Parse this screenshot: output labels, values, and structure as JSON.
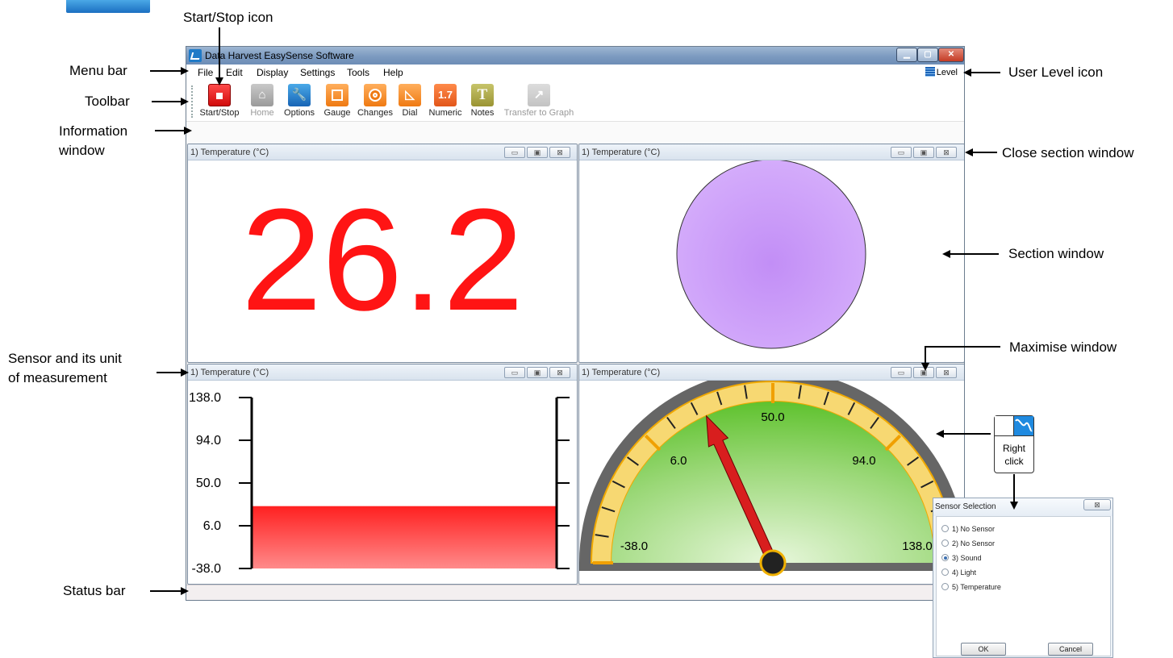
{
  "callouts": {
    "start_stop_icon": "Start/Stop icon",
    "menu_bar": "Menu bar",
    "toolbar": "Toolbar",
    "information_window_1": "Information",
    "information_window_2": "window",
    "sensor_unit_1": "Sensor and its unit",
    "sensor_unit_2": "of measurement",
    "status_bar": "Status bar",
    "user_level_icon": "User Level icon",
    "close_section_window": "Close section window",
    "section_window": "Section window",
    "maximise_window": "Maximise window",
    "right_click_1": "Right",
    "right_click_2": "click"
  },
  "window": {
    "title": "Data Harvest EasySense Software",
    "min": "▁",
    "max": "▢",
    "close": "✕"
  },
  "menu": {
    "items": [
      "File",
      "Edit",
      "Display",
      "Settings",
      "Tools",
      "Help"
    ],
    "level": "Level"
  },
  "toolbar": {
    "start_stop": "Start/Stop",
    "home": "Home",
    "options": "Options",
    "gauge": "Gauge",
    "changes": "Changes",
    "dial": "Dial",
    "numeric": "Numeric",
    "numeric_icon_text": "1.7",
    "notes": "Notes",
    "notes_icon_text": "T",
    "transfer": "Transfer to Graph"
  },
  "sections": {
    "numeric": {
      "title": "1) Temperature (°C)",
      "value": "26.2"
    },
    "color": {
      "title": "1) Temperature (°C)",
      "circle_color": "#c99bf9"
    },
    "gauge": {
      "title": "1) Temperature (°C)",
      "ticks": [
        "138.0",
        "94.0",
        "50.0",
        "6.0",
        "-38.0"
      ],
      "min": -38.0,
      "max": 138.0,
      "value": 26.2
    },
    "dial": {
      "title": "1) Temperature (°C)",
      "labels": [
        "-38.0",
        "6.0",
        "50.0",
        "94.0",
        "138.0"
      ],
      "min": -38.0,
      "max": 138.0,
      "value": 26.2
    },
    "button_min": "▭",
    "button_max": "▣",
    "button_close": "⊠"
  },
  "dialog": {
    "title": "Sensor Selection",
    "close": "⊠",
    "options": [
      "1) No Sensor",
      "2) No Sensor",
      "3) Sound",
      "4) Light",
      "5) Temperature"
    ],
    "selected_index": 2,
    "ok": "OK",
    "cancel": "Cancel"
  },
  "colors": {
    "numeric_red": "#ff1414",
    "gauge_red": "#ff2a2a",
    "dial_green": "#63c734",
    "dial_yellow": "#f4d05c",
    "needle_red": "#d81e1e"
  }
}
